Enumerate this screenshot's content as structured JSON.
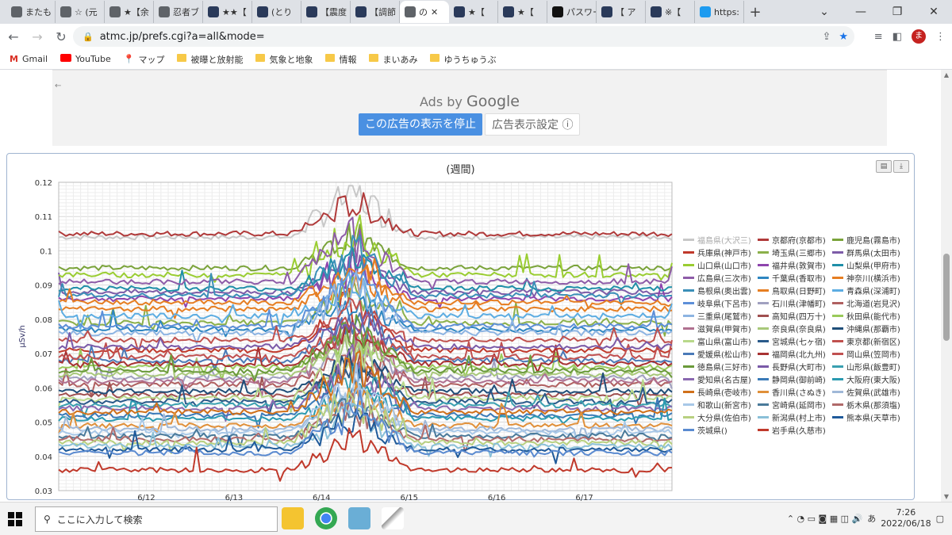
{
  "browser": {
    "tabs": [
      {
        "label": "またも",
        "color": "#5f6368"
      },
      {
        "label": "☆ (元",
        "color": "#5f6368"
      },
      {
        "label": "★【余",
        "color": "#5f6368"
      },
      {
        "label": "忍者ブ",
        "color": "#5f6368"
      },
      {
        "label": "★★【",
        "color": "#2a3a5a"
      },
      {
        "label": "(とり",
        "color": "#2a3a5a"
      },
      {
        "label": "【震度",
        "color": "#2a3a5a"
      },
      {
        "label": "【調節",
        "color": "#2a3a5a"
      },
      {
        "label": "の",
        "color": "#5f6368",
        "active": true
      },
      {
        "label": "★【",
        "color": "#2a3a5a"
      },
      {
        "label": "★【",
        "color": "#2a3a5a"
      },
      {
        "label": "パスワー",
        "color": "#111111"
      },
      {
        "label": "【 ア",
        "color": "#2a3a5a"
      },
      {
        "label": "※【",
        "color": "#2a3a5a"
      },
      {
        "label": "https:",
        "color": "#1d9bf0"
      }
    ],
    "url": "atmc.jp/prefs.cgi?a=all&mode=",
    "profile_initial": "ま",
    "bookmarks": [
      {
        "label": "Gmail",
        "icon": "gmail-icon"
      },
      {
        "label": "YouTube",
        "icon": "youtube-icon"
      },
      {
        "label": "マップ",
        "icon": "maps-icon"
      },
      {
        "label": "被曝と放射能",
        "icon": "folder-icon"
      },
      {
        "label": "気象と地象",
        "icon": "folder-icon"
      },
      {
        "label": "情報",
        "icon": "folder-icon"
      },
      {
        "label": "まいあみ",
        "icon": "folder-icon"
      },
      {
        "label": "ゆうちゅうぶ",
        "icon": "folder-icon"
      }
    ]
  },
  "ad": {
    "ads_by": "Ads by",
    "google": "Google",
    "stop_label": "この広告の表示を停止",
    "settings_label": "広告表示設定 ⓘ"
  },
  "chart_data": {
    "type": "line",
    "title": "(週間)",
    "ylabel": "μSv/h",
    "ylim": [
      0.03,
      0.12
    ],
    "yticks": [
      "0.12",
      "0.11",
      "0.1",
      "0.09",
      "0.08",
      "0.07",
      "0.06",
      "0.05",
      "0.04",
      "0.03"
    ],
    "xticks": [
      "6/12",
      "6/13",
      "6/14",
      "6/15",
      "6/16",
      "6/17"
    ],
    "grid": true,
    "legend_position": "right",
    "series": [
      {
        "name": "福島県(大沢三)",
        "color": "#c8c8c8",
        "base": 0.104
      },
      {
        "name": "京都府(京都市)",
        "color": "#b03a3a",
        "base": 0.105
      },
      {
        "name": "鹿児島(霧島市)",
        "color": "#7aa33a",
        "base": 0.095
      },
      {
        "name": "兵庫県(神戸市)",
        "color": "#c0392b",
        "base": 0.071
      },
      {
        "name": "埼玉県(三郷市)",
        "color": "#8bb04a",
        "base": 0.079
      },
      {
        "name": "群馬県(太田市)",
        "color": "#7d5ca8",
        "base": 0.088
      },
      {
        "name": "山口県(山口市)",
        "color": "#9acd32",
        "base": 0.093
      },
      {
        "name": "福井県(敦賀市)",
        "color": "#8e44ad",
        "base": 0.086
      },
      {
        "name": "山梨県(甲府市)",
        "color": "#1f8fa8",
        "base": 0.089
      },
      {
        "name": "広島県(三次市)",
        "color": "#8e5ca8",
        "base": 0.091
      },
      {
        "name": "千葉県(香取市)",
        "color": "#2e86c1",
        "base": 0.077
      },
      {
        "name": "神奈川(横浜市)",
        "color": "#e67e22",
        "base": 0.083
      },
      {
        "name": "島根県(奥出雲)",
        "color": "#3b8fb8",
        "base": 0.087
      },
      {
        "name": "鳥取県(日野町)",
        "color": "#e67e22",
        "base": 0.085
      },
      {
        "name": "青森県(深浦町)",
        "color": "#5dade2",
        "base": 0.081
      },
      {
        "name": "岐阜県(下呂市)",
        "color": "#5d8fd8",
        "base": 0.078
      },
      {
        "name": "石川県(津幡町)",
        "color": "#a0a0c0",
        "base": 0.063
      },
      {
        "name": "北海道(岩見沢)",
        "color": "#b06060",
        "base": 0.061
      },
      {
        "name": "三重県(尾鷲市)",
        "color": "#8db4e2",
        "base": 0.076
      },
      {
        "name": "高知県(四万十)",
        "color": "#a05050",
        "base": 0.058
      },
      {
        "name": "秋田県(能代市)",
        "color": "#9aca5a",
        "base": 0.066
      },
      {
        "name": "滋賀県(甲賀市)",
        "color": "#b07090",
        "base": 0.062
      },
      {
        "name": "奈良県(奈良県)",
        "color": "#a8c87a",
        "base": 0.064
      },
      {
        "name": "沖縄県(那覇市)",
        "color": "#1f4e79",
        "base": 0.059
      },
      {
        "name": "富山県(富山市)",
        "color": "#b8d88a",
        "base": 0.057
      },
      {
        "name": "宮城県(七ヶ宿)",
        "color": "#2a5a8a",
        "base": 0.056
      },
      {
        "name": "東京都(新宿区)",
        "color": "#c0504d",
        "base": 0.074
      },
      {
        "name": "愛媛県(松山市)",
        "color": "#4a7ab8",
        "base": 0.068
      },
      {
        "name": "福岡県(北九州)",
        "color": "#a83232",
        "base": 0.067
      },
      {
        "name": "岡山県(笠岡市)",
        "color": "#c05050",
        "base": 0.069
      },
      {
        "name": "徳島県(三好市)",
        "color": "#6a9a3a",
        "base": 0.065
      },
      {
        "name": "長野県(大町市)",
        "color": "#7a5aa8",
        "base": 0.072
      },
      {
        "name": "山形県(飯豊町)",
        "color": "#3aa0b0",
        "base": 0.055
      },
      {
        "name": "愛知県(名古屋)",
        "color": "#8a68b0",
        "base": 0.054
      },
      {
        "name": "静岡県(御前崎)",
        "color": "#3a7ab8",
        "base": 0.052
      },
      {
        "name": "大阪府(東大阪)",
        "color": "#2a9ab0",
        "base": 0.051
      },
      {
        "name": "長崎県(壱岐市)",
        "color": "#d0701a",
        "base": 0.053
      },
      {
        "name": "香川県(さぬき)",
        "color": "#e0903a",
        "base": 0.049
      },
      {
        "name": "佐賀県(武雄市)",
        "color": "#a0b8d8",
        "base": 0.048
      },
      {
        "name": "和歌山(新宮市)",
        "color": "#a8c8e8",
        "base": 0.047
      },
      {
        "name": "宮崎県(延岡市)",
        "color": "#4a7a9a",
        "base": 0.046
      },
      {
        "name": "栃木県(那須塩)",
        "color": "#b06a6a",
        "base": 0.045
      },
      {
        "name": "大分県(佐伯市)",
        "color": "#b8d080",
        "base": 0.044
      },
      {
        "name": "新潟県(村上市)",
        "color": "#8ac0d8",
        "base": 0.043
      },
      {
        "name": "熊本県(天草市)",
        "color": "#1f5a9a",
        "base": 0.042
      },
      {
        "name": "茨城県()",
        "color": "#5a8ad0",
        "base": 0.041
      },
      {
        "name": "岩手県(久慈市)",
        "color": "#c0392b",
        "base": 0.036
      }
    ]
  },
  "taskbar": {
    "search_placeholder": "ここに入力して検索",
    "time": "7:26",
    "date": "2022/06/18",
    "ime": "あ"
  }
}
